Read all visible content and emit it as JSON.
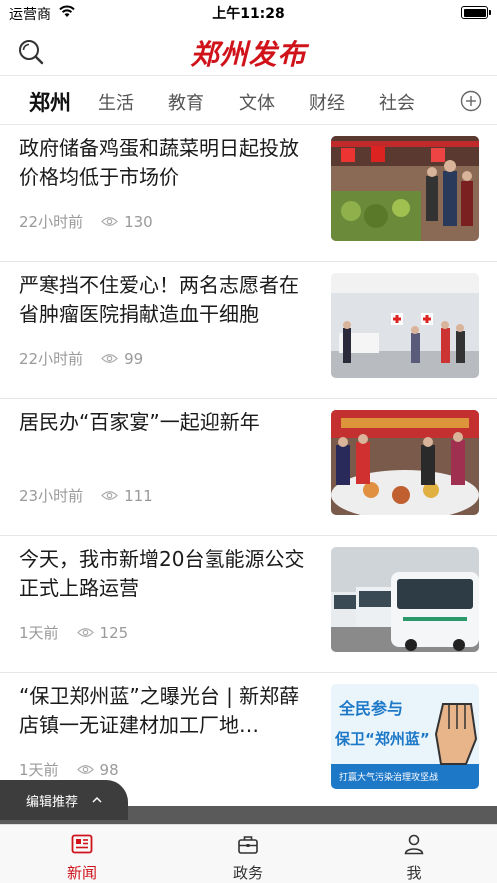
{
  "status_bar": {
    "carrier": "运营商",
    "time": "上午11:28"
  },
  "header": {
    "logo_text": "郑州发布",
    "brand_color": "#d0121b"
  },
  "tabs": [
    {
      "label": "郑州",
      "active": true
    },
    {
      "label": "生活"
    },
    {
      "label": "教育"
    },
    {
      "label": "文体"
    },
    {
      "label": "财经"
    },
    {
      "label": "社会"
    }
  ],
  "articles": [
    {
      "title": "政府储备鸡蛋和蔬菜明日起投放 价格均低于市场价",
      "time": "22小时前",
      "views": "130",
      "thumb": "supermarket-photo"
    },
    {
      "title": "严寒挡不住爱心！两名志愿者在省肿瘤医院捐献造血干细胞",
      "time": "22小时前",
      "views": "99",
      "thumb": "hospital-photo"
    },
    {
      "title": "居民办“百家宴”一起迎新年",
      "time": "23小时前",
      "views": "111",
      "thumb": "banquet-photo"
    },
    {
      "title": "今天，我市新增20台氢能源公交正式上路运营",
      "time": "1天前",
      "views": "125",
      "thumb": "bus-photo"
    },
    {
      "title": "“保卫郑州蓝”之曝光台 | 新郑薛店镇一无证建材加工厂地…",
      "time": "1天前",
      "views": "98",
      "thumb": "poster-image",
      "poster": {
        "line1": "全民参与",
        "line2": "保卫“郑州蓝”",
        "line3": "打赢大气污染治理攻坚战"
      }
    }
  ],
  "recommend": {
    "label": "编辑推荐"
  },
  "bottom_nav": [
    {
      "label": "新闻",
      "icon": "news-icon",
      "active": true
    },
    {
      "label": "政务",
      "icon": "briefcase-icon"
    },
    {
      "label": "我",
      "icon": "person-icon"
    }
  ]
}
